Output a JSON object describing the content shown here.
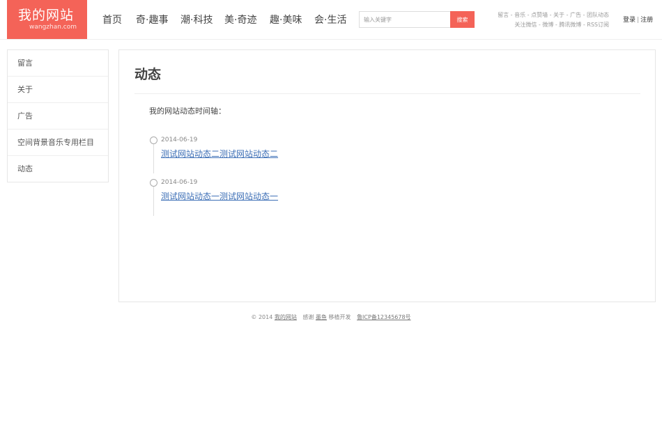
{
  "logo": {
    "title": "我的网站",
    "subtitle": "wangzhan.com"
  },
  "nav": [
    "首页",
    "奇·趣事",
    "潮·科技",
    "美·奇迹",
    "趣·美味",
    "会·生活"
  ],
  "search": {
    "placeholder": "输入关键字",
    "button": "搜索"
  },
  "toplinks": {
    "line1": "留言 - 音乐 - 点赞墙 - 关于 - 广告 - 团队动态",
    "line2": "关注微信 - 微博 - 腾讯微博 - RSS订阅"
  },
  "account": {
    "login": "登录",
    "register": "注册"
  },
  "sidebar": [
    "留言",
    "关于",
    "广告",
    "空间背景音乐专用栏目",
    "动态"
  ],
  "main": {
    "title": "动态",
    "intro": "我的网站动态时间轴：",
    "timeline": [
      {
        "date": "2014-06-19",
        "text": "测试网站动态二测试网站动态二"
      },
      {
        "date": "2014-06-19",
        "text": "测试网站动态一测试网站动态一"
      }
    ]
  },
  "footer": {
    "copyright": "© 2014",
    "site": "我的网站",
    "thanks": "感谢",
    "thanks_link": "墨鱼",
    "thanks_after": "移植开发",
    "icp": "鲁ICP备12345678号"
  },
  "colors": {
    "brand": "#f46358",
    "link": "#3d6fb6"
  }
}
